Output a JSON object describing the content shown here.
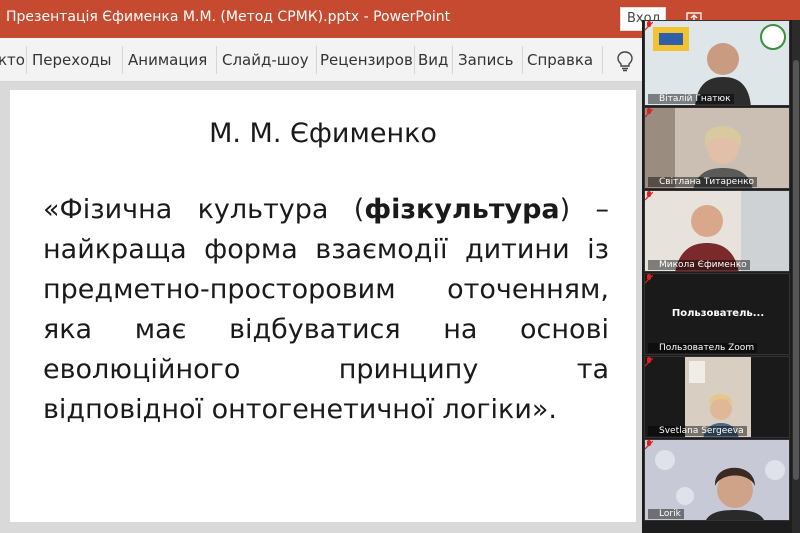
{
  "window": {
    "title": "Презентація Єфименка М.М. (Метод СРМК).pptx  -  PowerPoint",
    "signin_label": "Вход",
    "accent": "#c64a30"
  },
  "menubar": {
    "items": [
      "кто",
      "Переходы",
      "Анимация",
      "Слайд-шоу",
      "Рецензиров",
      "Вид",
      "Запись",
      "Справка"
    ],
    "tell_me_icon": "lightbulb-icon"
  },
  "slide": {
    "title": "М. М. Єфименко",
    "lines": [
      {
        "words": [
          "«Фізична",
          "культура",
          "(фізкультура)",
          "–"
        ],
        "bold_word": "фізкультура"
      },
      {
        "words": [
          "найкраща",
          "форма",
          "взаємодії",
          "дитини",
          "із"
        ]
      },
      {
        "words": [
          "предметно-просторовим",
          "оточенням,"
        ]
      },
      {
        "words": [
          "яка",
          "має",
          "відбуватися",
          "на",
          "основі"
        ]
      },
      {
        "words": [
          "еволюційного",
          "принципу",
          "та"
        ]
      },
      {
        "words": [
          "відповідної онтогенетичної логіки»."
        ]
      }
    ]
  },
  "participants": [
    {
      "name": "Віталій Гнатюк",
      "bg": "#c9d6df",
      "muted": true
    },
    {
      "name": "Світлана Титаренко",
      "bg": "#b7a79a",
      "muted": true
    },
    {
      "name": "Микола Єфименко",
      "bg": "#d9d4cc",
      "muted": true
    },
    {
      "name": "Пользователь Zoom",
      "display": "Пользователь...",
      "bg": "#1a1a1a",
      "muted": true
    },
    {
      "name": "Svetlana Sergeeva",
      "bg": "#d0c6b8",
      "muted": true
    },
    {
      "name": "Lorik",
      "bg": "#c9ccd6",
      "muted": true
    }
  ]
}
